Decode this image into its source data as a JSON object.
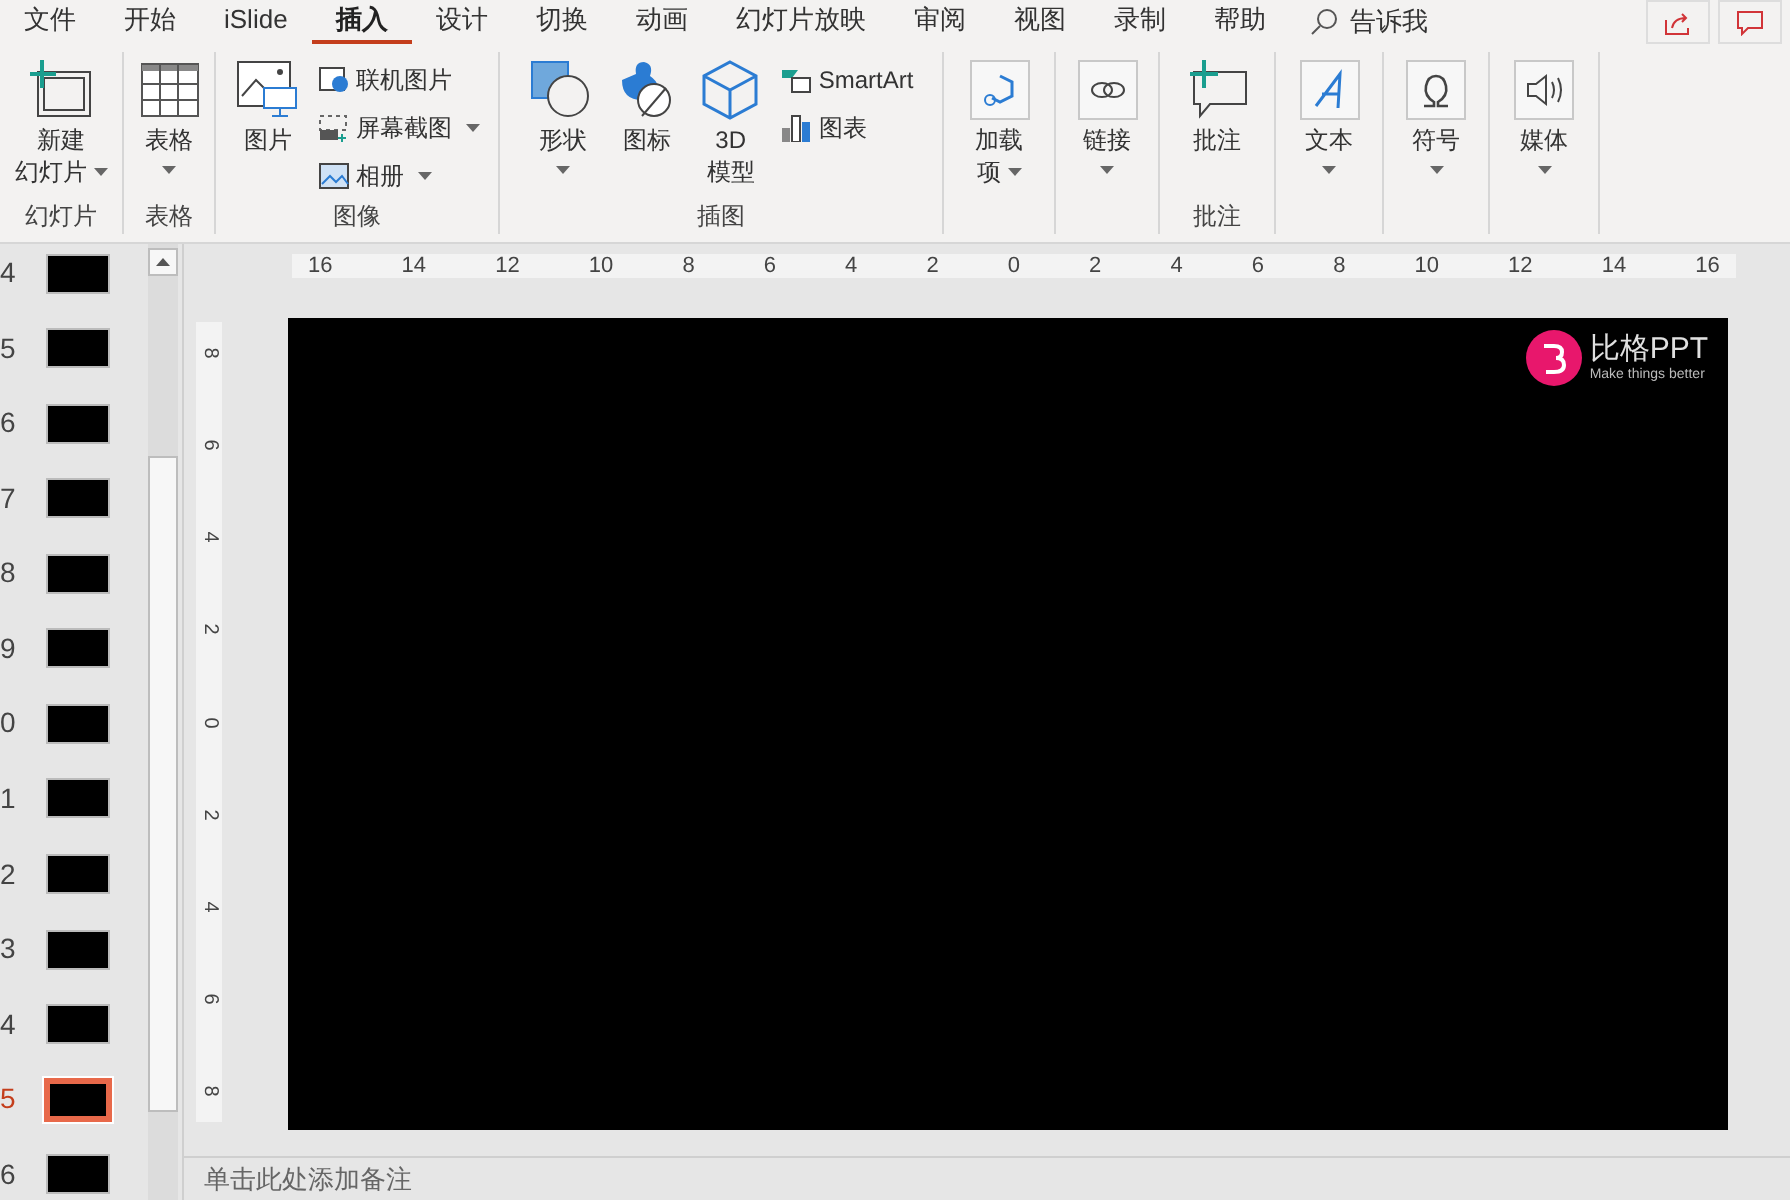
{
  "tabs": [
    {
      "label": "文件",
      "selected": false
    },
    {
      "label": "开始",
      "selected": false
    },
    {
      "label": "iSlide",
      "selected": false
    },
    {
      "label": "插入",
      "selected": true
    },
    {
      "label": "设计",
      "selected": false
    },
    {
      "label": "切换",
      "selected": false
    },
    {
      "label": "动画",
      "selected": false
    },
    {
      "label": "幻灯片放映",
      "selected": false
    },
    {
      "label": "审阅",
      "selected": false
    },
    {
      "label": "视图",
      "selected": false
    },
    {
      "label": "录制",
      "selected": false
    },
    {
      "label": "帮助",
      "selected": false
    }
  ],
  "tell_me": "告诉我",
  "ribbon_groups": [
    {
      "label": "幻灯片",
      "buttons": [
        {
          "kind": "large",
          "lines": [
            "新建",
            "幻灯片"
          ],
          "dropdown": true
        }
      ]
    },
    {
      "label": "表格",
      "buttons": [
        {
          "kind": "large",
          "lines": [
            "表格"
          ],
          "dropdown": true
        }
      ]
    },
    {
      "label": "图像",
      "buttons": [
        {
          "kind": "large",
          "lines": [
            "图片"
          ],
          "dropdown": false
        },
        {
          "kind": "small",
          "lines": [
            "联机图片"
          ],
          "dropdown": false
        },
        {
          "kind": "small",
          "lines": [
            "屏幕截图"
          ],
          "dropdown": true
        },
        {
          "kind": "small",
          "lines": [
            "相册"
          ],
          "dropdown": true
        }
      ]
    },
    {
      "label": "插图",
      "buttons": [
        {
          "kind": "large",
          "lines": [
            "形状"
          ],
          "dropdown": true
        },
        {
          "kind": "large",
          "lines": [
            "图标"
          ],
          "dropdown": false
        },
        {
          "kind": "large",
          "lines": [
            "3D",
            "模型"
          ],
          "dropdown": false
        },
        {
          "kind": "small",
          "lines": [
            "SmartArt"
          ],
          "dropdown": false
        },
        {
          "kind": "small",
          "lines": [
            "图表"
          ],
          "dropdown": false
        }
      ]
    },
    {
      "buttons": [
        {
          "kind": "large",
          "lines": [
            "加载",
            "项"
          ],
          "dropdown": true
        }
      ]
    },
    {
      "buttons": [
        {
          "kind": "large",
          "lines": [
            "链接"
          ],
          "dropdown": true
        }
      ]
    },
    {
      "label": "批注",
      "buttons": [
        {
          "kind": "large",
          "lines": [
            "批注"
          ],
          "dropdown": false
        }
      ]
    },
    {
      "buttons": [
        {
          "kind": "large",
          "lines": [
            "文本"
          ],
          "dropdown": true
        }
      ]
    },
    {
      "buttons": [
        {
          "kind": "large",
          "lines": [
            "符号"
          ],
          "dropdown": true
        }
      ]
    },
    {
      "buttons": [
        {
          "kind": "large",
          "lines": [
            "媒体"
          ],
          "dropdown": true
        }
      ]
    }
  ],
  "slides": [
    {
      "number": "4",
      "selected": false
    },
    {
      "number": "5",
      "selected": false
    },
    {
      "number": "6",
      "selected": false
    },
    {
      "number": "7",
      "selected": false
    },
    {
      "number": "8",
      "selected": false
    },
    {
      "number": "9",
      "selected": false
    },
    {
      "number": "0",
      "selected": false
    },
    {
      "number": "1",
      "selected": false
    },
    {
      "number": "2",
      "selected": false
    },
    {
      "number": "3",
      "selected": false
    },
    {
      "number": "4",
      "selected": false
    },
    {
      "number": "5",
      "selected": true
    },
    {
      "number": "6",
      "selected": false
    }
  ],
  "horizontal_ruler": [
    "16",
    "14",
    "12",
    "10",
    "8",
    "6",
    "4",
    "2",
    "0",
    "2",
    "4",
    "6",
    "8",
    "10",
    "12",
    "14",
    "16"
  ],
  "vertical_ruler": [
    "8",
    "6",
    "4",
    "2",
    "0",
    "2",
    "4",
    "6",
    "8"
  ],
  "slide_logo": {
    "name": "比格PPT",
    "tagline": "Make things better"
  },
  "notes": {
    "placeholder": "单击此处添加备注"
  }
}
